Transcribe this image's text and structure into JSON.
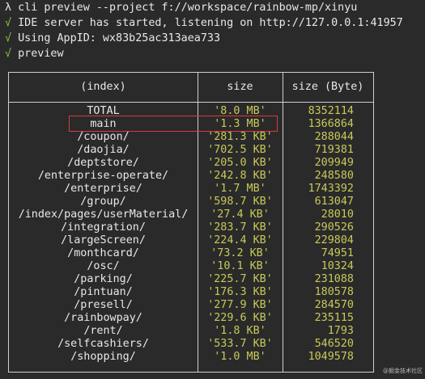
{
  "terminal": {
    "lines": [
      {
        "prefix": "λ",
        "text": "cli preview --project f://workspace/rainbow-mp/xinyu",
        "kind": "prompt"
      },
      {
        "prefix": "√",
        "text": "IDE server has started, listening on http://127.0.0.1:41957",
        "kind": "check"
      },
      {
        "prefix": "√",
        "text": "Using AppID: wx83b25ac313aea733",
        "kind": "check"
      },
      {
        "prefix": "√",
        "text": "preview",
        "kind": "check"
      }
    ]
  },
  "table": {
    "headers": [
      "(index)",
      "size",
      "size (Byte)"
    ],
    "rows": [
      {
        "index": "TOTAL",
        "size": "'8.0 MB'",
        "bytes": "8352114"
      },
      {
        "index": "main",
        "size": "'1.3 MB'",
        "bytes": "1366864"
      },
      {
        "index": "/coupon/",
        "size": "'281.3 KB'",
        "bytes": "288044"
      },
      {
        "index": "/daojia/",
        "size": "'702.5 KB'",
        "bytes": "719381"
      },
      {
        "index": "/deptstore/",
        "size": "'205.0 KB'",
        "bytes": "209949"
      },
      {
        "index": "/enterprise-operate/",
        "size": "'242.8 KB'",
        "bytes": "248580"
      },
      {
        "index": "/enterprise/",
        "size": "'1.7 MB'",
        "bytes": "1743392"
      },
      {
        "index": "/group/",
        "size": "'598.7 KB'",
        "bytes": "613047"
      },
      {
        "index": "/index/pages/userMaterial/",
        "size": "'27.4 KB'",
        "bytes": "28010"
      },
      {
        "index": "/integration/",
        "size": "'283.7 KB'",
        "bytes": "290526"
      },
      {
        "index": "/largeScreen/",
        "size": "'224.4 KB'",
        "bytes": "229804"
      },
      {
        "index": "/monthcard/",
        "size": "'73.2 KB'",
        "bytes": "74951"
      },
      {
        "index": "/osc/",
        "size": "'10.1 KB'",
        "bytes": "10324"
      },
      {
        "index": "/parking/",
        "size": "'225.7 KB'",
        "bytes": "231088"
      },
      {
        "index": "/pintuan/",
        "size": "'176.3 KB'",
        "bytes": "180578"
      },
      {
        "index": "/presell/",
        "size": "'277.9 KB'",
        "bytes": "284570"
      },
      {
        "index": "/rainbowpay/",
        "size": "'229.6 KB'",
        "bytes": "235115"
      },
      {
        "index": "/rent/",
        "size": "'1.8 KB'",
        "bytes": "1793"
      },
      {
        "index": "/selfcashiers/",
        "size": "'533.7 KB'",
        "bytes": "546520"
      },
      {
        "index": "/shopping/",
        "size": "'1.0 MB'",
        "bytes": "1049578"
      }
    ]
  },
  "highlight_row": "main",
  "watermark": "@掘金技术社区",
  "colors": {
    "background": "#2a2a2a",
    "text": "#e8e8e8",
    "check": "#8ec63f",
    "value": "#c9c95a",
    "highlight_border": "#d93a3a",
    "border": "#cfcfcf"
  }
}
